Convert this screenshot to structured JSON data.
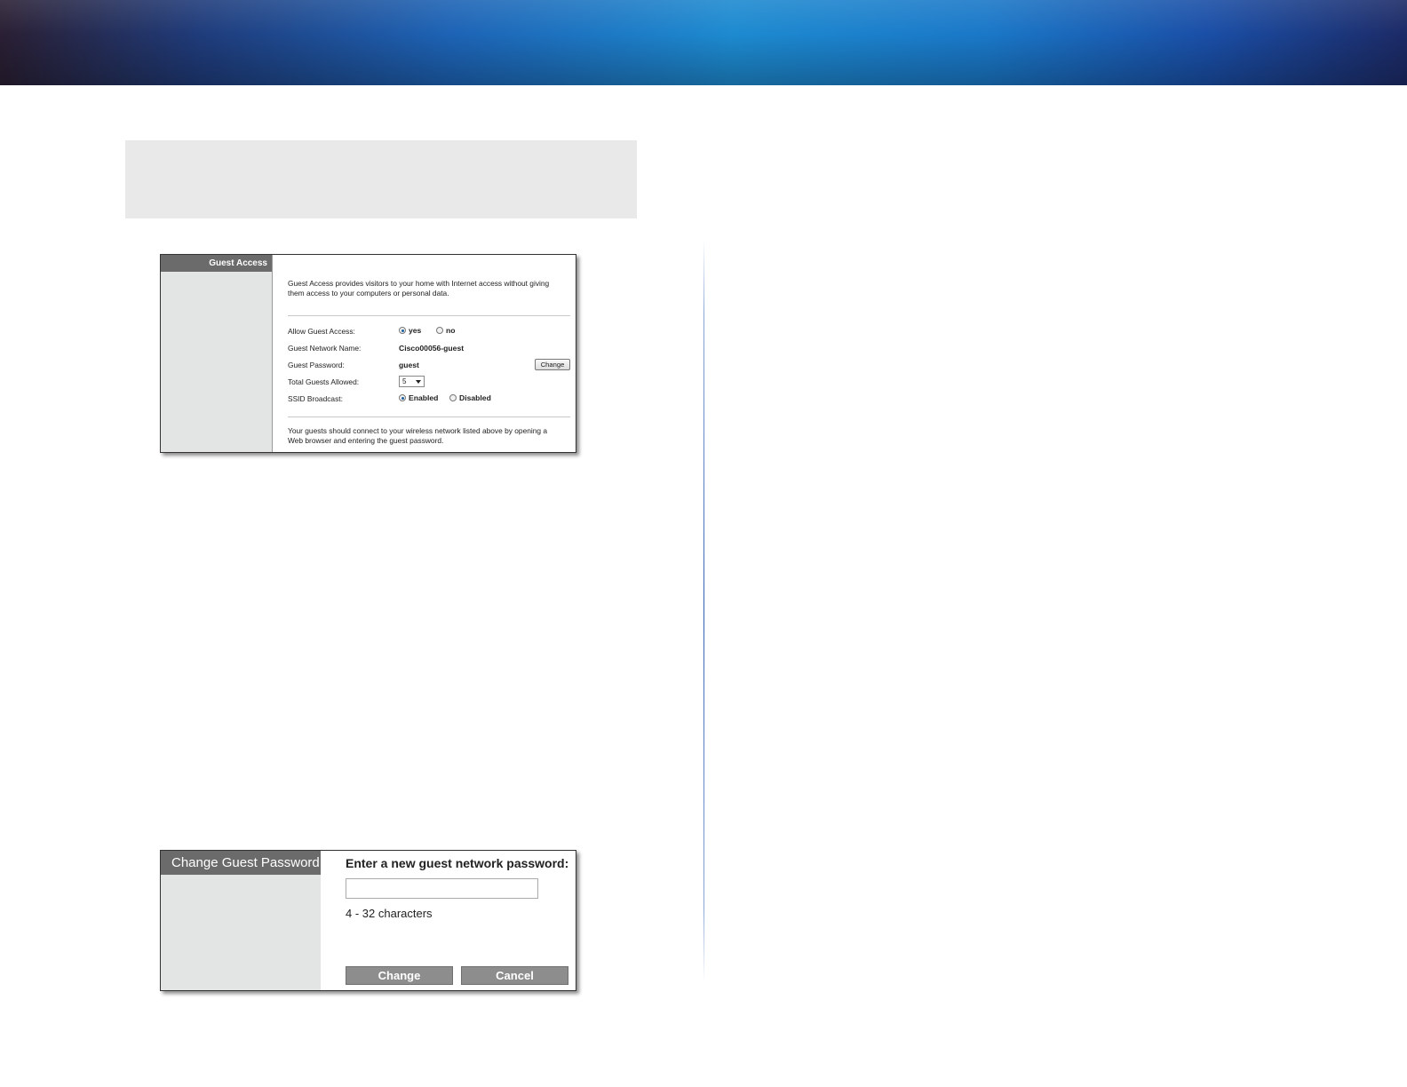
{
  "guest_access": {
    "section_title": "Guest Access",
    "intro": "Guest Access provides visitors to your home with Internet access without giving them access to your computers or personal data.",
    "rows": {
      "allow_label": "Allow Guest Access:",
      "allow_yes": "yes",
      "allow_no": "no",
      "allow_selected": "yes",
      "network_name_label": "Guest Network Name:",
      "network_name_value": "Cisco00056-guest",
      "password_label": "Guest Password:",
      "password_value": "guest",
      "change_button": "Change",
      "total_guests_label": "Total Guests Allowed:",
      "total_guests_value": "5",
      "ssid_label": "SSID Broadcast:",
      "ssid_enabled": "Enabled",
      "ssid_disabled": "Disabled",
      "ssid_selected": "Enabled"
    },
    "footer": "Your guests should connect to your wireless network listed above by opening a Web browser and entering the guest password."
  },
  "change_password": {
    "section_title": "Change Guest Password",
    "prompt": "Enter a new guest network password:",
    "input_value": "",
    "hint": "4 - 32 characters",
    "change_button": "Change",
    "cancel_button": "Cancel"
  },
  "colors": {
    "banner_blue": "#1d8ad0",
    "panel_header_gray": "#6b6b6b",
    "sidebar_gray": "#e3e5e4",
    "button_gray": "#8d8d8d"
  }
}
